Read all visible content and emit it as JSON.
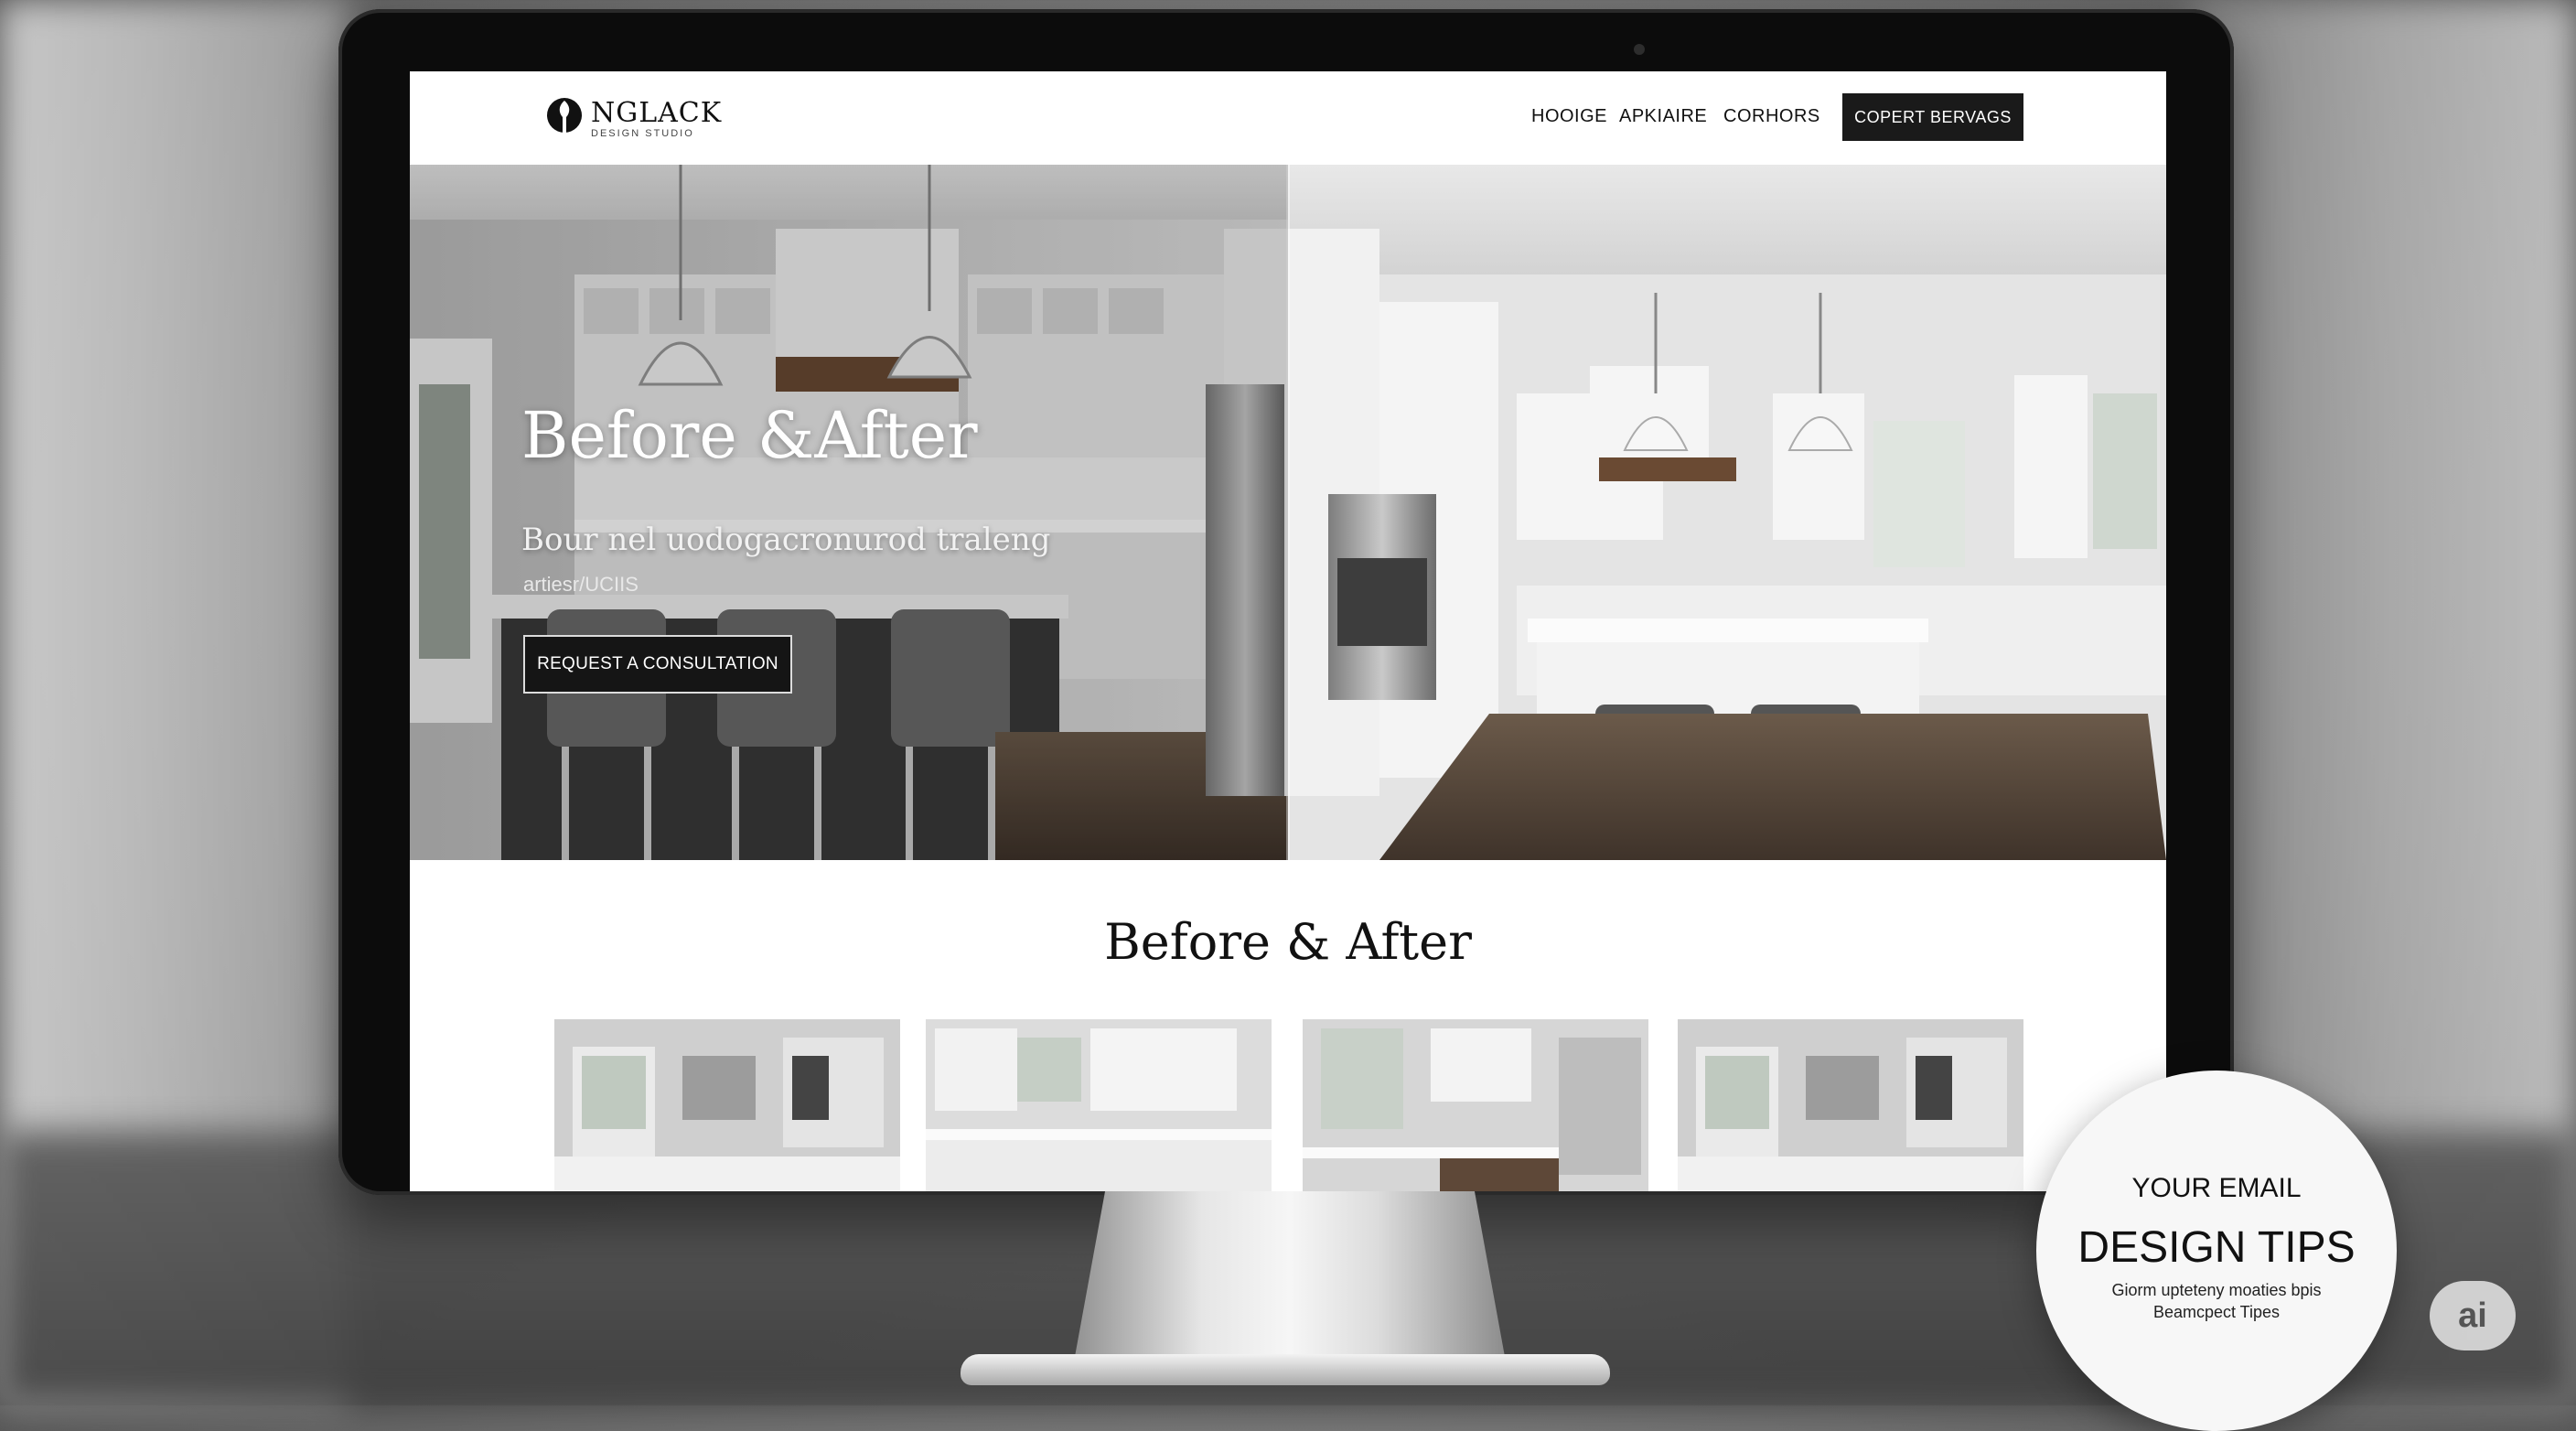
{
  "nav": {
    "logo_text": "NGLACK",
    "logo_sub": "DESIGN STUDIO",
    "links": [
      "HOOIGE",
      "APKIAIRE",
      "CORHORS"
    ],
    "cta_label": "COPERT BERVAGS"
  },
  "hero": {
    "title": "Before &After",
    "subtitle": "Bour nel uodogacronurod traleng",
    "subtitle2": "artiesr/UCIIS",
    "cta_label": "REQUEST A CONSULTATION"
  },
  "section": {
    "title": "Before & After",
    "thumbnails": [
      "kitchen-1",
      "kitchen-2",
      "kitchen-3",
      "kitchen-4"
    ]
  },
  "promo": {
    "line1": "YOUR EMAIL",
    "line2": "DESIGN TIPS",
    "line3a": "Giorm upteteny moaties bpis",
    "line3b": "Beamcpect Tipes"
  },
  "badge": {
    "label": "ai"
  },
  "colors": {
    "accent": "#1a1a1a",
    "screen_bg": "#ffffff"
  }
}
